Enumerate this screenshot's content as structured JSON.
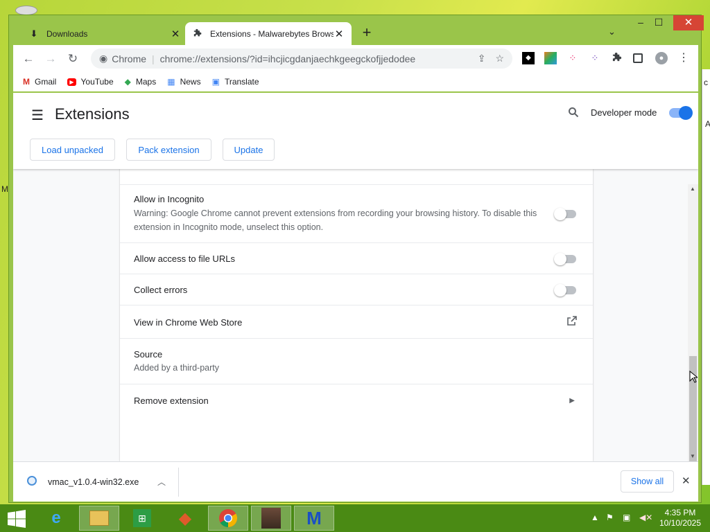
{
  "desktop": {
    "left_letter": "M",
    "right_letter_a": "A",
    "right_letter_c": "c"
  },
  "browser": {
    "tabs": [
      {
        "label": "Downloads",
        "icon": "download-icon"
      },
      {
        "label": "Extensions - Malwarebytes Brows",
        "icon": "puzzle-icon"
      }
    ],
    "new_tab": "+",
    "window_controls": {
      "minimize": "–",
      "maximize": "☐",
      "close": "✕"
    },
    "omnibox": {
      "site": "Chrome",
      "url": "chrome://extensions/?id=ihcjicgdanjaechkgeegckofjjedodee"
    },
    "bookmarks": [
      {
        "label": "Gmail",
        "icon": "gmail-icon",
        "color": "#d93025"
      },
      {
        "label": "YouTube",
        "icon": "youtube-icon",
        "color": "#ff0000"
      },
      {
        "label": "Maps",
        "icon": "maps-icon",
        "color": "#34a853"
      },
      {
        "label": "News",
        "icon": "news-icon",
        "color": "#4285f4"
      },
      {
        "label": "Translate",
        "icon": "translate-icon",
        "color": "#4285f4"
      }
    ]
  },
  "extensions_page": {
    "title": "Extensions",
    "developer_mode_label": "Developer mode",
    "developer_mode_on": true,
    "buttons": {
      "load_unpacked": "Load unpacked",
      "pack_extension": "Pack extension",
      "update": "Update"
    },
    "rows": {
      "incognito": {
        "label": "Allow in Incognito",
        "description": "Warning: Google Chrome cannot prevent extensions from recording your browsing history. To disable this extension in Incognito mode, unselect this option.",
        "enabled": false
      },
      "file_urls": {
        "label": "Allow access to file URLs",
        "enabled": false
      },
      "collect_errors": {
        "label": "Collect errors",
        "enabled": false
      },
      "web_store": {
        "label": "View in Chrome Web Store"
      },
      "source": {
        "label": "Source",
        "value": "Added by a third-party"
      },
      "remove": {
        "label": "Remove extension"
      }
    }
  },
  "download_bar": {
    "filename": "vmac_v1.0.4-win32.exe",
    "show_all": "Show all"
  },
  "taskbar": {
    "time": "4:35 PM",
    "date": "10/10/2025",
    "apps": [
      "internet-explorer-icon",
      "file-explorer-icon",
      "store-icon",
      "app-icon",
      "chrome-icon",
      "game-icon",
      "malwarebytes-icon"
    ]
  },
  "colors": {
    "accent": "#1a73e8",
    "taskbar": "#4a8a14",
    "desktop": "#c8e04a"
  }
}
